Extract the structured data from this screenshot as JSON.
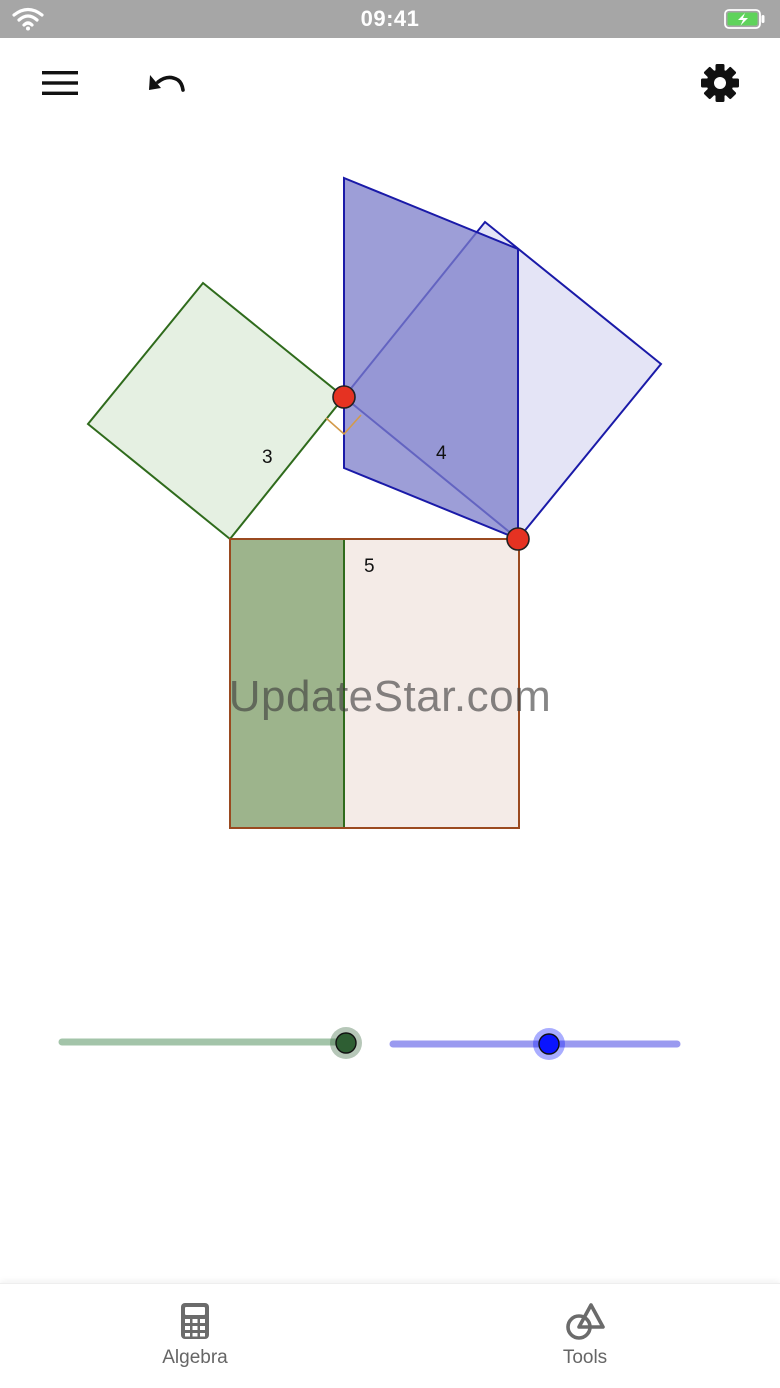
{
  "status_bar": {
    "time": "09:41"
  },
  "toolbar": {
    "menu_icon": "hamburger-menu-icon",
    "undo_icon": "undo-icon",
    "settings_icon": "gear-icon"
  },
  "construction": {
    "labels": {
      "side_a": "3",
      "side_b": "4",
      "side_c": "5"
    },
    "colors": {
      "green_square_fill": "#e5f0e2",
      "green_stroke": "#2f6b1c",
      "blue_fill": "#9a9bd4",
      "blue_light_fill": "#e4e4f6",
      "blue_stroke": "#1a1aa8",
      "pink_fill": "#f4ebe7",
      "brown_stroke": "#9a4a20",
      "dark_green_fill": "#9db48c",
      "point_red": "#e53222"
    }
  },
  "watermark": "UpdateStar.com",
  "sliders": [
    {
      "name": "green-slider",
      "value": 1.0,
      "track_color": "#a3c4a9",
      "knob_color": "#2e5e33"
    },
    {
      "name": "blue-slider",
      "value": 0.55,
      "track_color": "#9a9af0",
      "knob_color": "#0a14ff"
    }
  ],
  "bottom_nav": {
    "algebra": "Algebra",
    "tools": "Tools"
  }
}
